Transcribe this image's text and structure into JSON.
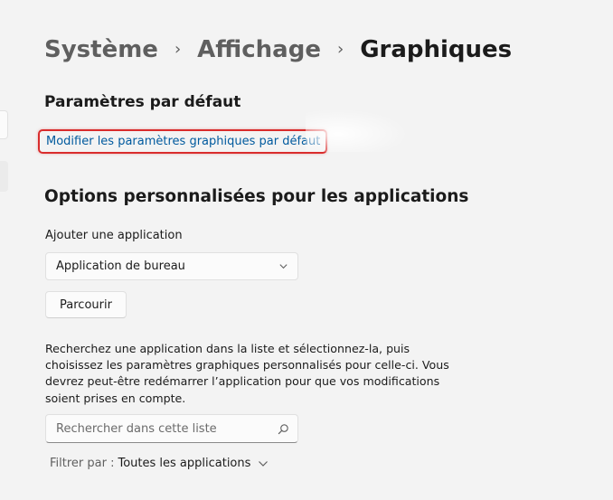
{
  "breadcrumb": {
    "items": [
      "Système",
      "Affichage",
      "Graphiques"
    ],
    "separator": "›"
  },
  "defaults": {
    "title": "Paramètres par défaut",
    "link_label": "Modifier les paramètres graphiques par défaut"
  },
  "custom": {
    "title": "Options personnalisées pour les applications",
    "add_label": "Ajouter une application",
    "app_type_selected": "Application de bureau",
    "browse_label": "Parcourir",
    "help_text": "Recherchez une application dans la liste et sélectionnez-la, puis choisissez les paramètres graphiques personnalisés pour celle-ci. Vous devrez peut-être redémarrer l’application pour que vos modifications soient prises en compte.",
    "search_placeholder": "Rechercher dans cette liste",
    "filter_label": "Filtrer par :",
    "filter_value": "Toutes les applications"
  },
  "colors": {
    "link": "#005a9e",
    "highlight_border": "#d92c2c",
    "background": "#f3f3f3"
  },
  "icons": {
    "search": "search-icon",
    "dropdown": "chevron-down-icon"
  }
}
